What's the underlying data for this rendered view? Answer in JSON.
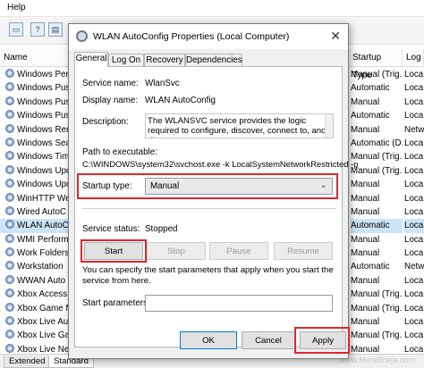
{
  "background": {
    "menu": [
      "Help"
    ],
    "headers": {
      "name": "Name",
      "startup_type": "Startup Type",
      "log_on_as": "Log"
    },
    "services": [
      {
        "name": "Windows Perf",
        "startup": "Manual (Trig...",
        "logon": "Loca"
      },
      {
        "name": "Windows Push",
        "startup": "Automatic",
        "logon": "Loca"
      },
      {
        "name": "Windows Push",
        "startup": "Manual",
        "logon": "Loca"
      },
      {
        "name": "Windows Push",
        "startup": "Automatic",
        "logon": "Loca"
      },
      {
        "name": "Windows Rem",
        "startup": "Manual",
        "logon": "Netw"
      },
      {
        "name": "Windows Sea",
        "startup": "Automatic (D...",
        "logon": "Loca"
      },
      {
        "name": "Windows Time",
        "startup": "Manual (Trig...",
        "logon": "Loca"
      },
      {
        "name": "Windows Upd",
        "startup": "Manual (Trig...",
        "logon": "Loca"
      },
      {
        "name": "Windows Upd",
        "startup": "Manual",
        "logon": "Loca"
      },
      {
        "name": "WinHTTP Wel",
        "startup": "Manual",
        "logon": "Loca"
      },
      {
        "name": "Wired AutoC",
        "startup": "Manual",
        "logon": "Loca"
      },
      {
        "name": "WLAN AutoC",
        "startup": "Automatic",
        "logon": "Loca"
      },
      {
        "name": "WMI Perform",
        "startup": "Manual",
        "logon": "Loca"
      },
      {
        "name": "Work Folders",
        "startup": "Manual",
        "logon": "Loca"
      },
      {
        "name": "Workstation",
        "startup": "Automatic",
        "logon": "Netw"
      },
      {
        "name": "WWAN Auto",
        "startup": "Manual",
        "logon": "Loca"
      },
      {
        "name": "Xbox Access",
        "startup": "Manual (Trig...",
        "logon": "Loca"
      },
      {
        "name": "Xbox Game M",
        "startup": "Manual (Trig...",
        "logon": "Loca"
      },
      {
        "name": "Xbox Live Au",
        "startup": "Manual",
        "logon": "Loca"
      },
      {
        "name": "Xbox Live Ga",
        "startup": "Manual (Trig...",
        "logon": "Loca"
      },
      {
        "name": "Xbox Live Ne",
        "startup": "Manual",
        "logon": "Loca"
      }
    ],
    "tabs": [
      "Extended",
      "Standard"
    ],
    "watermark": "www.MeraBheja.com"
  },
  "dialog": {
    "title": "WLAN AutoConfig Properties (Local Computer)",
    "tabs": [
      "General",
      "Log On",
      "Recovery",
      "Dependencies"
    ],
    "service_name_label": "Service name:",
    "service_name": "WlanSvc",
    "display_name_label": "Display name:",
    "display_name": "WLAN AutoConfig",
    "description_label": "Description:",
    "description": "The WLANSVC service provides the logic required to configure, discover, connect to, and disconnect",
    "path_label": "Path to executable:",
    "path": "C:\\WINDOWS\\system32\\svchost.exe -k LocalSystemNetworkRestricted -p",
    "startup_type_label": "Startup type:",
    "startup_type": "Manual",
    "service_status_label": "Service status:",
    "service_status": "Stopped",
    "buttons": {
      "start": "Start",
      "stop": "Stop",
      "pause": "Pause",
      "resume": "Resume"
    },
    "params_note": "You can specify the start parameters that apply when you start the service from here.",
    "start_params_label": "Start parameters:",
    "start_params_value": "",
    "footer": {
      "ok": "OK",
      "cancel": "Cancel",
      "apply": "Apply"
    },
    "highlight_color": "#e1262b"
  }
}
